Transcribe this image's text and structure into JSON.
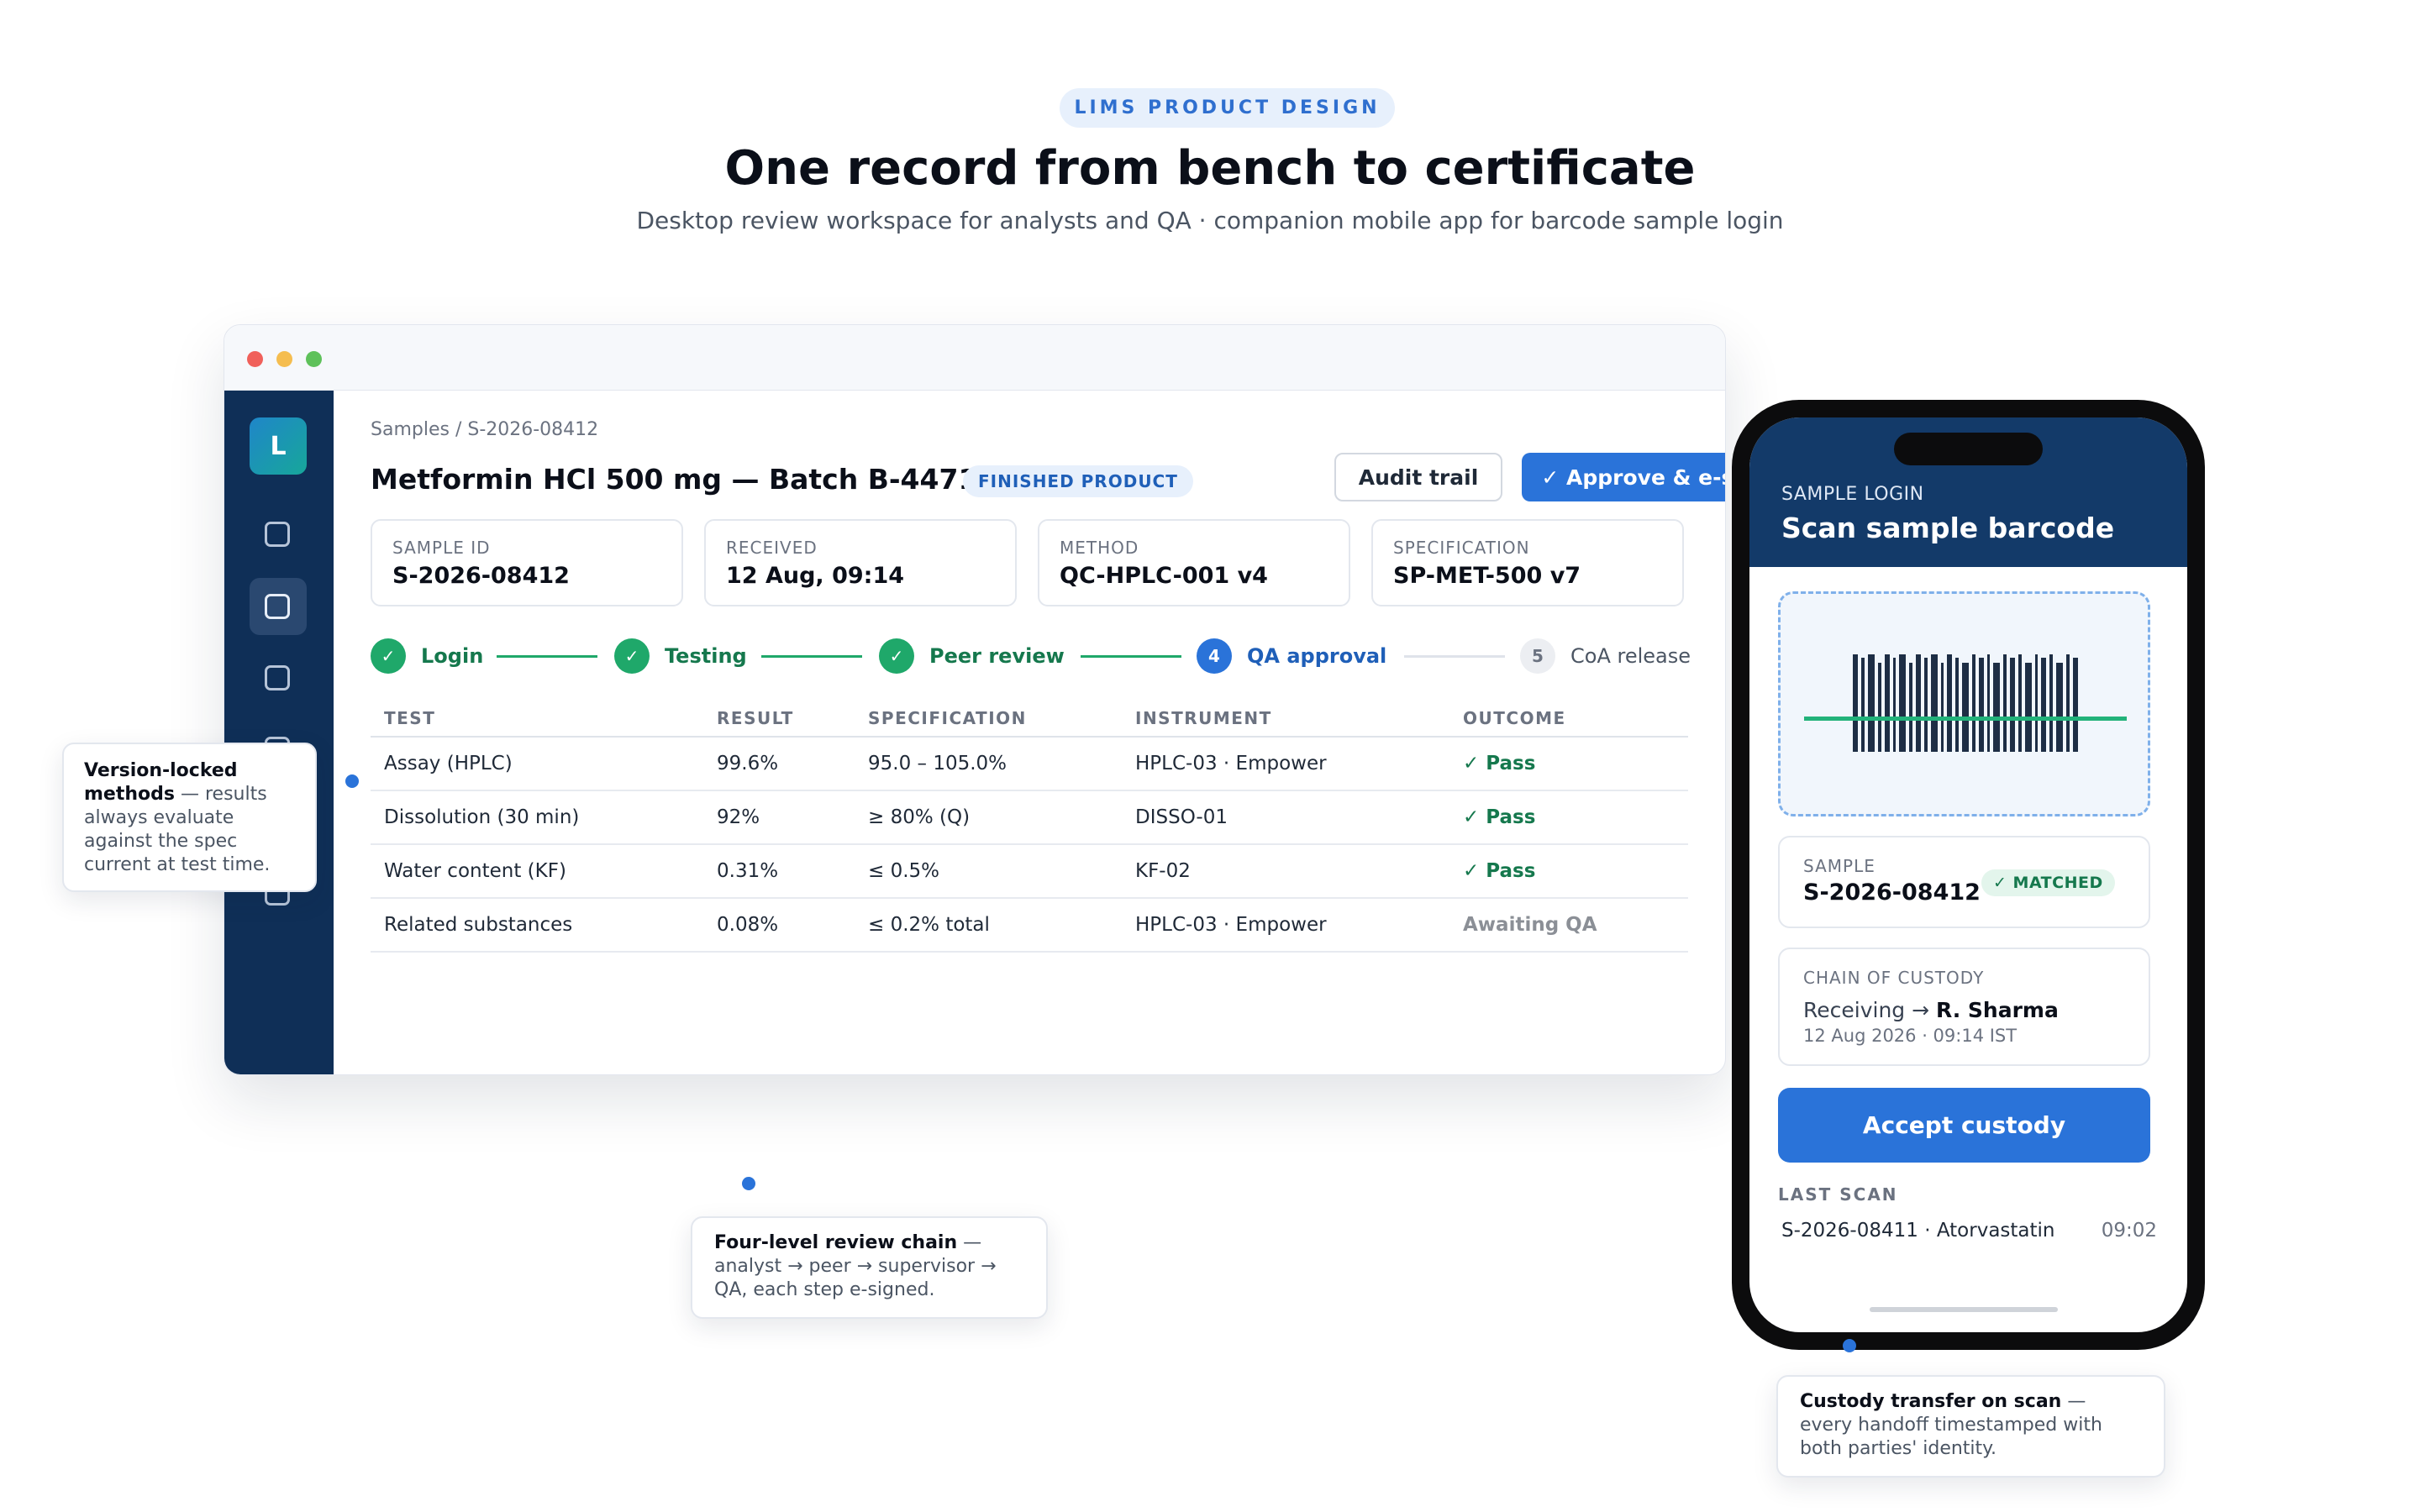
{
  "hero": {
    "eyebrow": "LIMS PRODUCT DESIGN",
    "title": "One record from bench to certificate",
    "subtitle": "Desktop review workspace for analysts and QA · companion mobile app for barcode sample login"
  },
  "desktop": {
    "logo_letter": "L",
    "breadcrumb": "Samples / S-2026-08412",
    "title": "Metformin HCl 500 mg — Batch B-4471",
    "badge": "FINISHED PRODUCT",
    "audit_label": "Audit trail",
    "approve_label": "✓ Approve & e-sign",
    "meta": [
      {
        "label": "SAMPLE ID",
        "value": "S-2026-08412"
      },
      {
        "label": "RECEIVED",
        "value": "12 Aug, 09:14"
      },
      {
        "label": "METHOD",
        "value": "QC-HPLC-001 v4"
      },
      {
        "label": "SPECIFICATION",
        "value": "SP-MET-500 v7"
      }
    ],
    "steps": [
      {
        "marker": "✓",
        "label": "Login",
        "state": "done"
      },
      {
        "marker": "✓",
        "label": "Testing",
        "state": "done"
      },
      {
        "marker": "✓",
        "label": "Peer review",
        "state": "done"
      },
      {
        "marker": "4",
        "label": "QA approval",
        "state": "current"
      },
      {
        "marker": "5",
        "label": "CoA release",
        "state": "pending"
      }
    ],
    "table": {
      "headers": [
        "TEST",
        "RESULT",
        "SPECIFICATION",
        "INSTRUMENT",
        "OUTCOME"
      ],
      "rows": [
        {
          "test": "Assay (HPLC)",
          "result": "99.6%",
          "spec": "95.0 – 105.0%",
          "instrument": "HPLC-03 · Empower",
          "outcome": "✓ Pass",
          "status": "pass"
        },
        {
          "test": "Dissolution (30 min)",
          "result": "92%",
          "spec": "≥ 80% (Q)",
          "instrument": "DISSO-01",
          "outcome": "✓ Pass",
          "status": "pass"
        },
        {
          "test": "Water content (KF)",
          "result": "0.31%",
          "spec": "≤ 0.5%",
          "instrument": "KF-02",
          "outcome": "✓ Pass",
          "status": "pass"
        },
        {
          "test": "Related substances",
          "result": "0.08%",
          "spec": "≤ 0.2% total",
          "instrument": "HPLC-03 · Empower",
          "outcome": "Awaiting QA",
          "status": "awaiting"
        }
      ]
    }
  },
  "callouts": {
    "version": {
      "bold": "Version-locked methods",
      "text": " — results always evaluate against the spec current at test time."
    },
    "review": {
      "bold": "Four-level review chain",
      "text": " — analyst → peer → supervisor → QA, each step e-signed."
    },
    "custody": {
      "bold": "Custody transfer on scan",
      "text": " — every handoff timestamped with both parties' identity."
    }
  },
  "mobile": {
    "eyebrow": "SAMPLE LOGIN",
    "title": "Scan sample barcode",
    "sample_label": "SAMPLE",
    "sample_value": "S-2026-08412",
    "matched": "✓ MATCHED",
    "custody_label": "CHAIN OF CUSTODY",
    "custody_from": "Receiving →",
    "custody_to": "R. Sharma",
    "custody_time": "12 Aug 2026 · 09:14 IST",
    "accept_label": "Accept custody",
    "last_scan_label": "LAST SCAN",
    "last_scan_item": "S-2026-08411 · Atorvastatin",
    "last_scan_time": "09:02"
  },
  "colors": {
    "accent": "#2a73d9",
    "navy": "#0f2f57",
    "success": "#1fa86a"
  }
}
